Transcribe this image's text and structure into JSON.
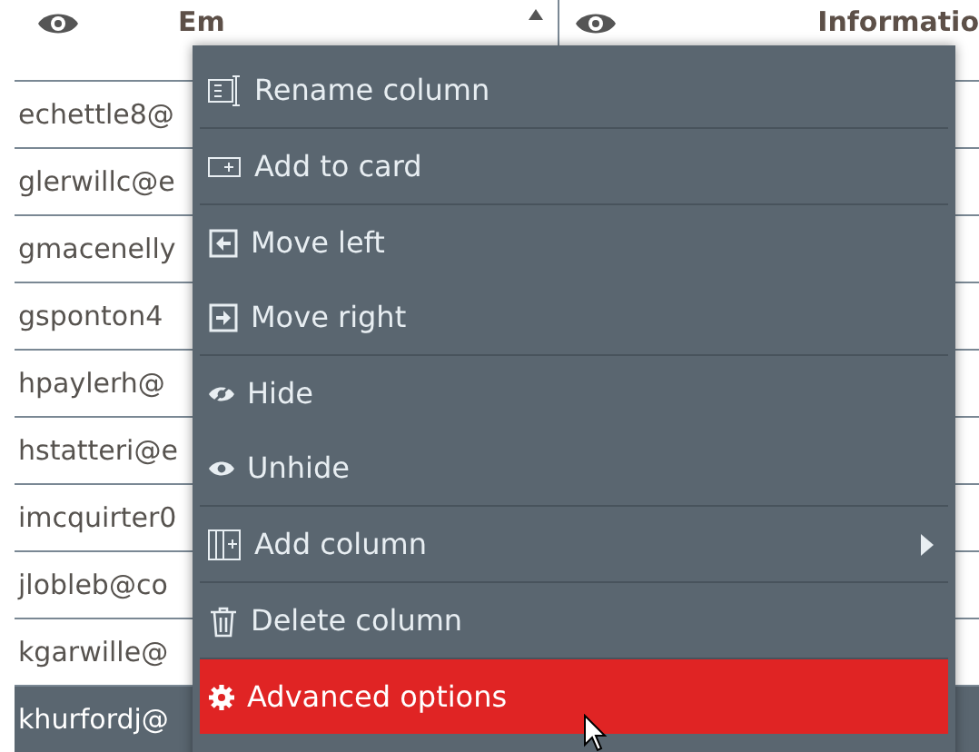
{
  "table": {
    "columns": [
      {
        "label": "Em",
        "sorted": true
      },
      {
        "label": "Informatio",
        "sorted": false
      }
    ],
    "rows": [
      {
        "email": "echettle8@",
        "selected": false
      },
      {
        "email": "glerwillc@e",
        "selected": false
      },
      {
        "email": "gmacenelly",
        "selected": false
      },
      {
        "email": "gsponton4",
        "selected": false
      },
      {
        "email": "hpaylerh@",
        "selected": false
      },
      {
        "email": "hstatteri@e",
        "selected": false
      },
      {
        "email": "imcquirter0",
        "selected": false
      },
      {
        "email": "jlobleb@co",
        "selected": false
      },
      {
        "email": "kgarwille@",
        "selected": false
      },
      {
        "email": "khurfordj@",
        "selected": true
      }
    ]
  },
  "context_menu": {
    "items": [
      {
        "kind": "rename",
        "label": "Rename column",
        "separator_after": true,
        "submenu": false,
        "selected": false
      },
      {
        "kind": "card",
        "label": "Add to card",
        "separator_after": true,
        "submenu": false,
        "selected": false
      },
      {
        "kind": "left",
        "label": "Move left",
        "separator_after": false,
        "submenu": false,
        "selected": false
      },
      {
        "kind": "right",
        "label": "Move right",
        "separator_after": true,
        "submenu": false,
        "selected": false
      },
      {
        "kind": "hide",
        "label": "Hide",
        "separator_after": false,
        "submenu": false,
        "selected": false
      },
      {
        "kind": "unhide",
        "label": "Unhide",
        "separator_after": true,
        "submenu": false,
        "selected": false
      },
      {
        "kind": "addcol",
        "label": "Add column",
        "separator_after": true,
        "submenu": true,
        "selected": false
      },
      {
        "kind": "delete",
        "label": "Delete column",
        "separator_after": true,
        "submenu": false,
        "selected": false
      },
      {
        "kind": "advanced",
        "label": "Advanced options",
        "separator_after": false,
        "submenu": false,
        "selected": true
      }
    ]
  }
}
